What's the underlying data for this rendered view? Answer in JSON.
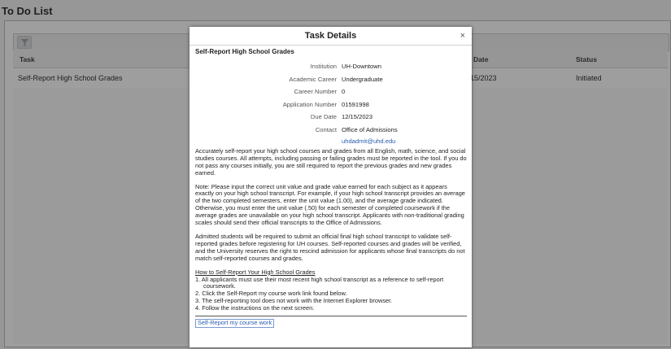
{
  "page": {
    "title": "To Do List",
    "table_headers": [
      "Task",
      "Date",
      "Status"
    ],
    "row": {
      "task": "Self-Report High School Grades",
      "date": "15/2023",
      "status": "Initiated"
    }
  },
  "modal": {
    "title": "Task Details",
    "close": "×",
    "task_name": "Self-Report High School Grades",
    "details": [
      {
        "label": "Institution",
        "value": "UH-Downtown"
      },
      {
        "label": "Academic Career",
        "value": "Undergraduate"
      },
      {
        "label": "Career Number",
        "value": "0"
      },
      {
        "label": "Application Number",
        "value": "01591998"
      },
      {
        "label": "Due Date",
        "value": "12/15/2023"
      },
      {
        "label": "Contact",
        "value": "Office of Admissions"
      }
    ],
    "email": "uhdadmit@uhd.edu",
    "paragraphs": [
      "Accurately self-report your high school courses and grades from all English, math, science, and social studies courses. All attempts, including passing or failing grades must be reported in the tool. If you do not pass any courses initially, you are still required to report the previous grades and new grades earned.",
      "Note: Please input the correct unit value and grade value earned for each subject as it appears exactly on your high school transcript. For example, if your high school transcript provides an average of the two completed semesters, enter the unit value (1.00), and the average grade indicated. Otherwise, you must enter the unit value (.50) for each semester of completed coursework if the average grades are unavailable on your high school transcript. Applicants with non-traditional grading scales should send their official transcripts to the Office of Admissions.",
      "Admitted students will be required to submit an official final high school transcript to validate self-reported grades before registering for UH courses. Self-reported courses and grades will be verified, and the University reserves the right to rescind admission for applicants whose final transcripts do not match self-reported courses and grades."
    ],
    "howto_title": "How to Self-Report Your High School Grades",
    "steps": [
      "1. All applicants must use their most recent high school transcript as a reference to self-report",
      "coursework.",
      "2. Click the Self-Report my course work link found below.",
      "3. The self-reporting tool does not work with the Internet Explorer browser.",
      "4. Follow the instructions on the next screen."
    ],
    "link": "Self-Report my course work"
  },
  "icons": {
    "filter": "filter-icon",
    "close": "close-icon"
  }
}
